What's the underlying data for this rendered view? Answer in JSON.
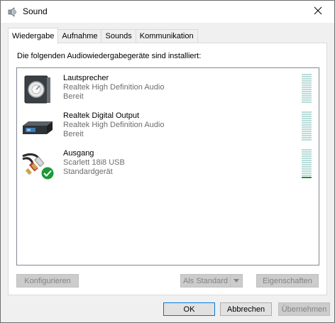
{
  "window": {
    "title": "Sound",
    "title_icon": "speaker-icon"
  },
  "tabs": [
    {
      "label": "Wiedergabe",
      "active": true
    },
    {
      "label": "Aufnahme",
      "active": false
    },
    {
      "label": "Sounds",
      "active": false
    },
    {
      "label": "Kommunikation",
      "active": false
    }
  ],
  "panel": {
    "heading": "Die folgenden Audiowiedergabegeräte sind installiert:"
  },
  "devices": [
    {
      "name": "Lautsprecher",
      "description": "Realtek High Definition Audio",
      "status": "Bereit",
      "icon": "speaker-icon",
      "level": 0,
      "is_default": false
    },
    {
      "name": "Realtek Digital Output",
      "description": "Realtek High Definition Audio",
      "status": "Bereit",
      "icon": "digital-output-icon",
      "level": 0,
      "is_default": false
    },
    {
      "name": "Ausgang",
      "description": "Scarlett 18i8 USB",
      "status": "Standardgerät",
      "icon": "rca-cable-icon",
      "level": 0.1,
      "is_default": true
    }
  ],
  "buttons": {
    "configure": "Konfigurieren",
    "set_default": "Als Standard",
    "properties": "Eigenschaften",
    "ok": "OK",
    "cancel": "Abbrechen",
    "apply": "Übernehmen"
  },
  "colors": {
    "accent": "#0078d7",
    "meter_idle": "#b9dcd9",
    "meter_active": "#1f8a3a",
    "default_check": "#1c9a36"
  }
}
